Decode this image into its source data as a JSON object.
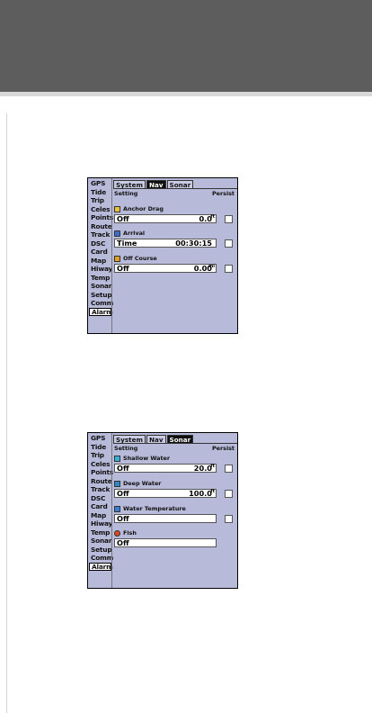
{
  "screen1": {
    "sidebar": [
      "GPS",
      "Tide",
      "Trip",
      "Celes",
      "Points",
      "Route",
      "Track",
      "DSC",
      "Card",
      "Map",
      "Hiway",
      "Temp",
      "Sonar",
      "Setup",
      "Comm",
      "Alarm"
    ],
    "selected_sidebar": "Alarm",
    "tabs": [
      "System",
      "Nav",
      "Sonar"
    ],
    "active_tab": "Nav",
    "col_setting": "Setting",
    "col_persist": "Persist",
    "rows": [
      {
        "label": "Anchor Drag",
        "mode": "Off",
        "value": "0.0",
        "unit": "ft",
        "icon": "anchor-icon"
      },
      {
        "label": "Arrival",
        "mode": "Time",
        "value": "00:30:15",
        "unit": "",
        "icon": "clock-icon"
      },
      {
        "label": "Off Course",
        "mode": "Off",
        "value": "0.00",
        "unit": "mi",
        "icon": "off-course-icon"
      }
    ]
  },
  "screen2": {
    "sidebar": [
      "GPS",
      "Tide",
      "Trip",
      "Celes",
      "Points",
      "Route",
      "Track",
      "DSC",
      "Card",
      "Map",
      "Hiway",
      "Temp",
      "Sonar",
      "Setup",
      "Comm",
      "Alarm"
    ],
    "selected_sidebar": "Alarm",
    "tabs": [
      "System",
      "Nav",
      "Sonar"
    ],
    "active_tab": "Sonar",
    "col_setting": "Setting",
    "col_persist": "Persist",
    "rows": [
      {
        "label": "Shallow Water",
        "mode": "Off",
        "value": "20.0",
        "unit": "ft",
        "icon": "shallow-water-icon"
      },
      {
        "label": "Deep Water",
        "mode": "Off",
        "value": "100.0",
        "unit": "ft",
        "icon": "deep-water-icon"
      },
      {
        "label": "Water Temperature",
        "mode": "Off",
        "value": "",
        "unit": "",
        "icon": "water-temperature-icon"
      },
      {
        "label": "Fish",
        "mode": "Off",
        "value": "",
        "unit": "",
        "icon": "fish-icon"
      }
    ]
  }
}
